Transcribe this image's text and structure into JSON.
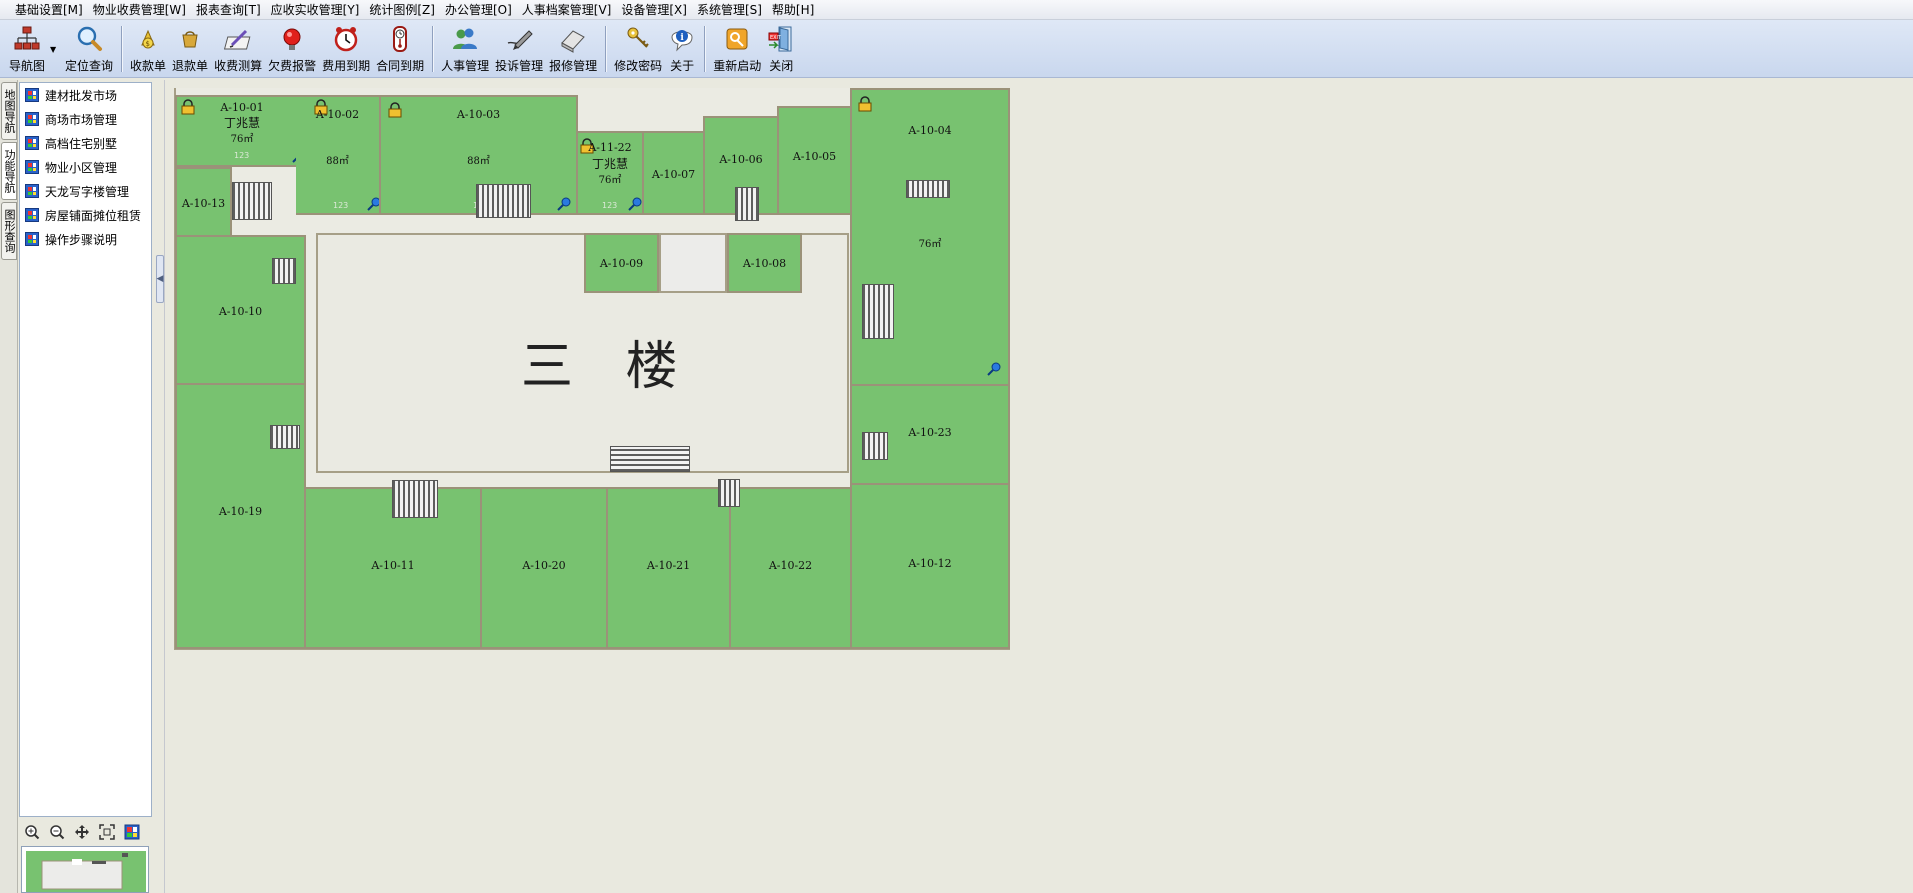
{
  "menu": [
    "基础设置[M]",
    "物业收费管理[W]",
    "报表查询[T]",
    "应收实收管理[Y]",
    "统计图例[Z]",
    "办公管理[O]",
    "人事档案管理[V]",
    "设备管理[X]",
    "系统管理[S]",
    "帮助[H]"
  ],
  "toolbar": {
    "nav_map": "导航图",
    "locate": "定位查询",
    "receipt": "收款单",
    "refund": "退款单",
    "fee_calc": "收费测算",
    "arrears_alert": "欠费报警",
    "fee_due": "费用到期",
    "contract_due": "合同到期",
    "hr": "人事管理",
    "complaint": "投诉管理",
    "repair": "报修管理",
    "change_pwd": "修改密码",
    "about": "关于",
    "restart": "重新启动",
    "close": "关闭"
  },
  "side_tabs": [
    "地图导航",
    "功能导航",
    "图形查询"
  ],
  "tree": [
    "建材批发市场",
    "商场市场管理",
    "高档住宅别墅",
    "物业小区管理",
    "天龙写字楼管理",
    "房屋铺面摊位租赁",
    "操作步骤说明"
  ],
  "map": {
    "floor_title": "三 楼",
    "rooms": {
      "r01": {
        "id": "A-10-01",
        "owner": "丁兆慧",
        "area": "76㎡",
        "code": "123"
      },
      "r02": {
        "id": "A-10-02",
        "area": "88㎡",
        "code": "123"
      },
      "r03": {
        "id": "A-10-03",
        "area": "88㎡",
        "code": "123"
      },
      "r22": {
        "id": "A-11-22",
        "owner": "丁兆慧",
        "area": "76㎡",
        "code": "123"
      },
      "r07": {
        "id": "A-10-07"
      },
      "r06": {
        "id": "A-10-06"
      },
      "r05": {
        "id": "A-10-05"
      },
      "r04": {
        "id": "A-10-04",
        "area": "76㎡"
      },
      "r13": {
        "id": "A-10-13"
      },
      "r09": {
        "id": "A-10-09"
      },
      "r08": {
        "id": "A-10-08"
      },
      "r10": {
        "id": "A-10-10"
      },
      "r23": {
        "id": "A-10-23"
      },
      "r19": {
        "id": "A-10-19"
      },
      "r11": {
        "id": "A-10-11"
      },
      "r20": {
        "id": "A-10-20"
      },
      "r21": {
        "id": "A-10-21"
      },
      "r1022": {
        "id": "A-10-22"
      },
      "r12": {
        "id": "A-10-12"
      }
    }
  },
  "colors": {
    "room_fill": "#78c270",
    "room_border": "#9b9279",
    "toolbar_bg": "#c9d7ee"
  }
}
